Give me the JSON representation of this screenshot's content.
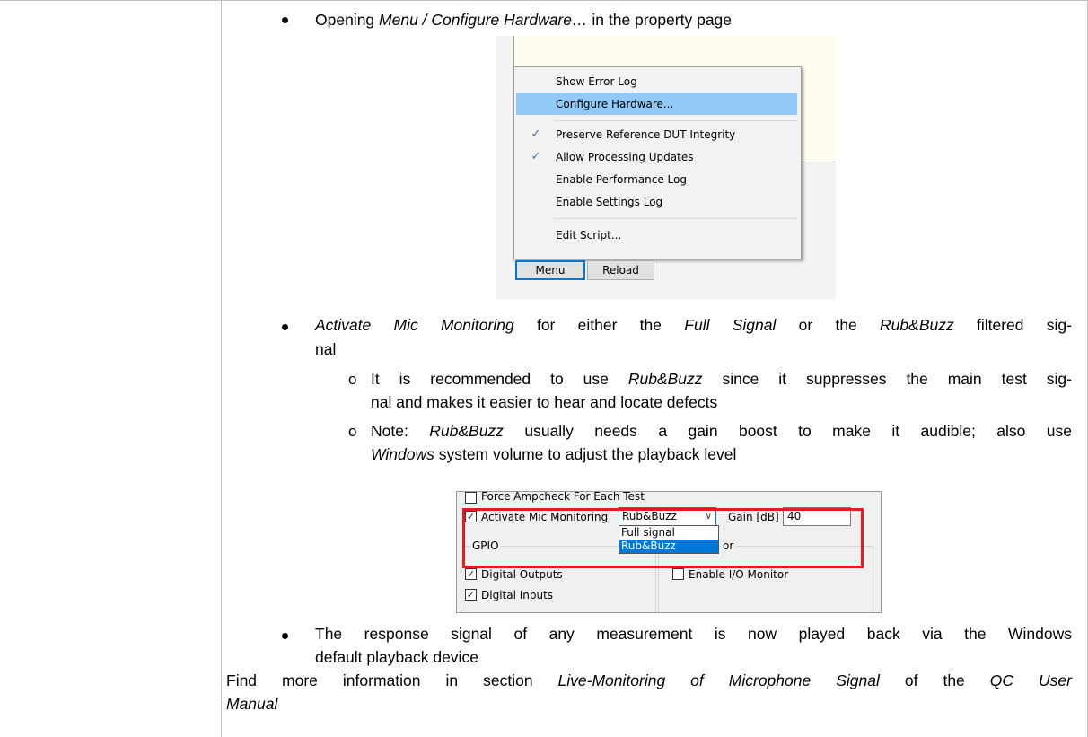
{
  "bullets": {
    "b1": {
      "prefix": "Opening ",
      "italic": "Menu / Configure Hardware…",
      "suffix": " in the property page"
    },
    "b2": {
      "l1a": "Activate Mic Monitoring",
      "l1b": " for either the ",
      "l1c": "Full Signal",
      "l1d": " or the ",
      "l1e": "Rub&Buzz",
      "l1f": " filtered sig-",
      "l2": "nal"
    },
    "sub1": {
      "l1a": "It is recommended to use ",
      "l1b": "Rub&Buzz",
      "l1c": " since it suppresses the main test sig-",
      "l2": "nal and makes it easier to hear and locate defects"
    },
    "sub2": {
      "l1a": "Note: ",
      "l1b": "Rub&Buzz",
      "l1c": " usually needs a gain boost to make it audible; also use",
      "l2a": "Windows",
      "l2b": " system volume to adjust the playback level"
    },
    "b3": {
      "l1": "The response signal of any measurement is now played back via the Windows",
      "l2": "default playback device"
    }
  },
  "footer": {
    "l1a": "Find more information in section ",
    "l1b": "Live-Monitoring of Microphone Signal",
    "l1c": " of the ",
    "l1d": "QC User",
    "l2": "Manual"
  },
  "context_menu": {
    "items": [
      "Show Error Log",
      "Configure Hardware...",
      "Preserve Reference DUT Integrity",
      "Allow Processing Updates",
      "Enable Performance Log",
      "Enable Settings Log",
      "Edit Script..."
    ],
    "checkmark": "✓",
    "highlight_color": "#91c9f7",
    "menu_button": "Menu",
    "reload_button": "Reload"
  },
  "settings": {
    "force_ampcheck": "Force Ampcheck For Each Test",
    "activate_mic": "Activate Mic Monitoring",
    "combo_value": "Rub&Buzz",
    "options": [
      "Full signal",
      "Rub&Buzz"
    ],
    "gain_label": "Gain [dB]",
    "gain_value": "40",
    "gpio_label": "GPIO",
    "digital_outputs": "Digital Outputs",
    "digital_inputs": "Digital Inputs",
    "enable_io_monitor": "Enable I/O Monitor",
    "monitor_group_tail": "or",
    "highlight_box_color": "#e8191f"
  }
}
